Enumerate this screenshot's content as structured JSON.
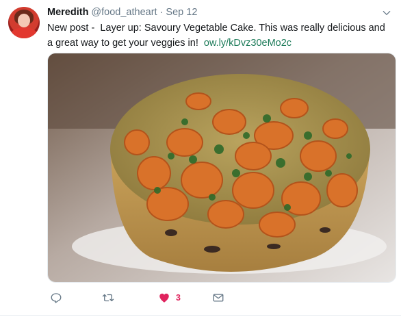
{
  "author": {
    "display_name": "Meredith",
    "handle": "@food_atheart",
    "separator": "·",
    "date": "Sep 12"
  },
  "tweet": {
    "text": "New post -  Layer up: Savoury Vegetable Cake. This was really delicious and a great way to get your veggies in!",
    "link": "ow.ly/kDvz30eMo2c"
  },
  "media": {
    "description_icon": "photo"
  },
  "actions": {
    "like_count": "3"
  },
  "colors": {
    "link": "#1b7a58",
    "like": "#e0245e",
    "icon": "#657786"
  }
}
